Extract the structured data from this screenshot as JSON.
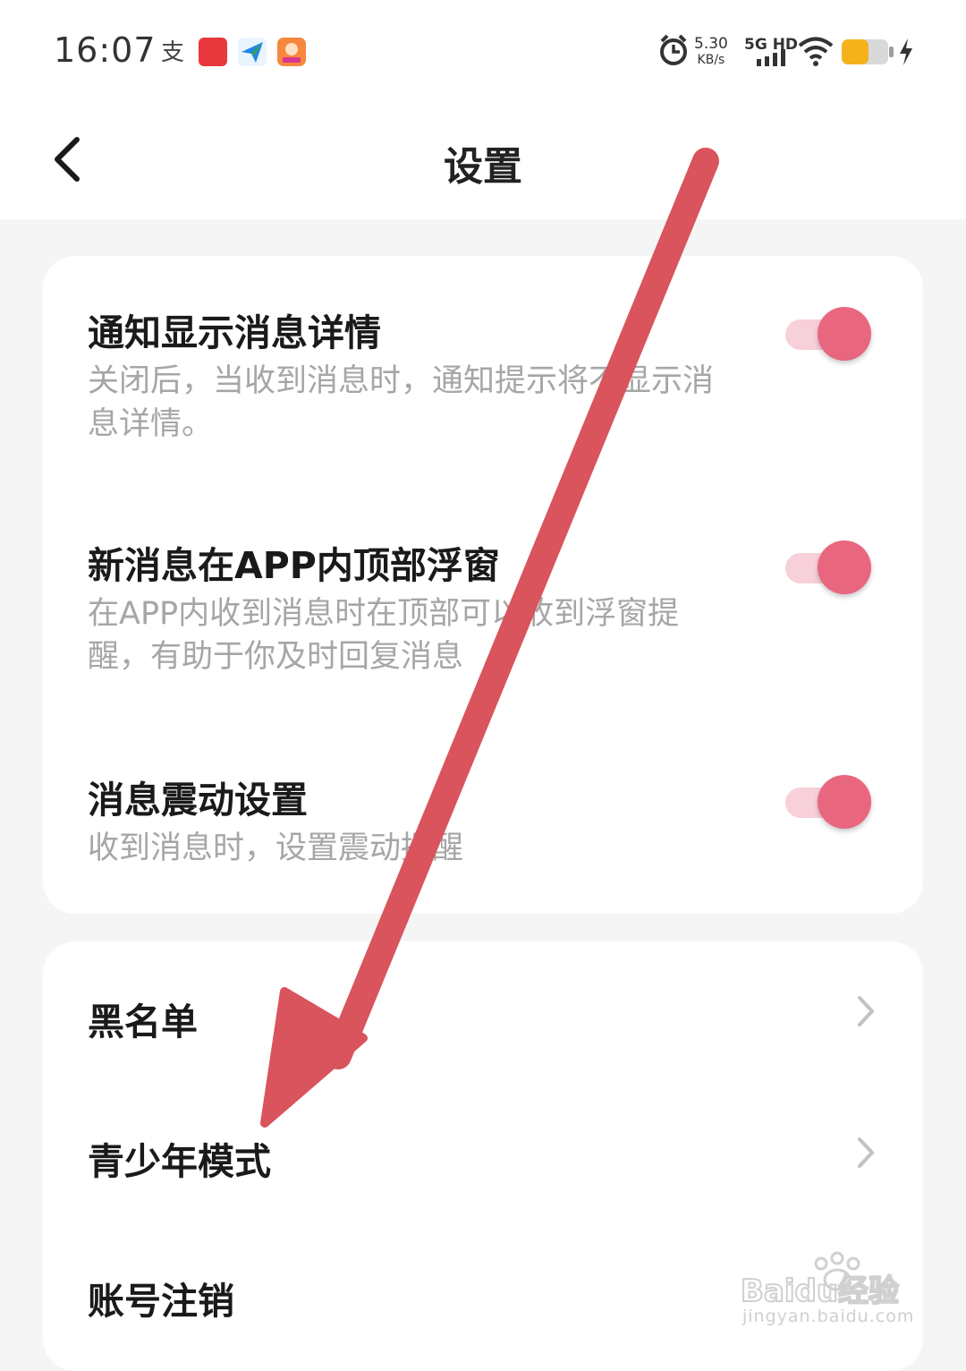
{
  "status_bar": {
    "time": "16:07",
    "net_speed_value": "5.30",
    "net_speed_unit": "KB/s",
    "network": "5G HD",
    "icons": [
      "alipay-icon",
      "news-app-icon",
      "plane-app-icon",
      "photo-app-icon",
      "alarm-icon",
      "signal-icon",
      "wifi-icon",
      "battery-icon",
      "charging-icon"
    ]
  },
  "header": {
    "title": "设置",
    "back_icon": "back-arrow-icon"
  },
  "notification_settings": [
    {
      "title": "通知显示消息详情",
      "description": "关闭后，当收到消息时，通知提示将不显示消息详情。",
      "enabled": true
    },
    {
      "title": "新消息在APP内顶部浮窗",
      "description": "在APP内收到消息时在顶部可以收到浮窗提醒，有助于你及时回复消息",
      "enabled": true
    },
    {
      "title": "消息震动设置",
      "description": "收到消息时，设置震动提醒",
      "enabled": true
    }
  ],
  "nav_items": [
    {
      "label": "黑名单",
      "icon": "chevron-right-icon"
    },
    {
      "label": "青少年模式",
      "icon": "chevron-right-icon"
    },
    {
      "label": "账号注销",
      "icon": "chevron-right-icon"
    }
  ],
  "colors": {
    "accent": "#e9667f",
    "toggle_track": "#f8d0d9",
    "annotation_arrow": "#d9545c",
    "background": "#f5f5f5"
  },
  "watermark": {
    "brand": "Baidu经验",
    "url": "jingyan.baidu.com"
  }
}
